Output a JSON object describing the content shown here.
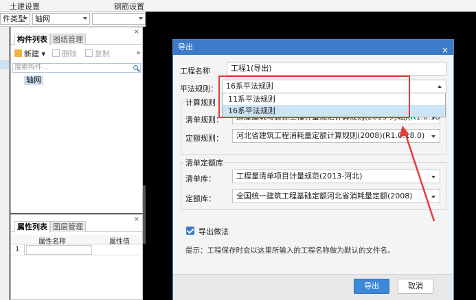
{
  "menu": {
    "item1": "土建设置",
    "item2": "钢筋设置"
  },
  "toolbar": {
    "type_label": "件类型",
    "type_value": "轴网",
    "extra_value": ""
  },
  "component_panel": {
    "tab_components": "构件列表",
    "tab_drawings": "图纸管理",
    "new_label": "新建",
    "delete_label": "删除",
    "copy_label": "复制",
    "search_placeholder": "搜索构件...",
    "tree_item": "轴网",
    "close": "×",
    "more": "»"
  },
  "property_panel": {
    "tab_properties": "属性列表",
    "tab_layers": "图层管理",
    "col_name": "属性名称",
    "col_value": "属性值",
    "row_num": "1",
    "close": "×"
  },
  "dialog": {
    "title": "导出",
    "close": "×",
    "project_name_label": "工程名称",
    "project_name_value": "工程1(导出)",
    "rule_label": "平法规则：",
    "rule_value": "16系平法规则",
    "rule_options": [
      "11系平法规则",
      "16系平法规则"
    ],
    "calc_group": "计算规则",
    "bill_rule_label": "清单规则：",
    "bill_rule_value": "房屋建筑与装饰工程计量规范计算规则(2013-河北)(R1.0.18.0)",
    "quota_rule_label": "定额规则：",
    "quota_rule_value": "河北省建筑工程消耗量定额计算规则(2008)(R1.0.18.0)",
    "lib_group": "清单定额库",
    "bill_lib_label": "清单库：",
    "bill_lib_value": "工程量清单项目计量规范(2013-河北)",
    "quota_lib_label": "定额库：",
    "quota_lib_value": "全国统一建筑工程基础定额河北省消耗量定额(2008)",
    "export_method_label": "导出做法",
    "hint": "提示：工程保存时会以这里所输入的工程名称做为默认的文件名。",
    "ok": "导出",
    "cancel": "取消"
  },
  "colors": {
    "accent": "#3b7bc8",
    "annotation": "#e53a3a"
  }
}
